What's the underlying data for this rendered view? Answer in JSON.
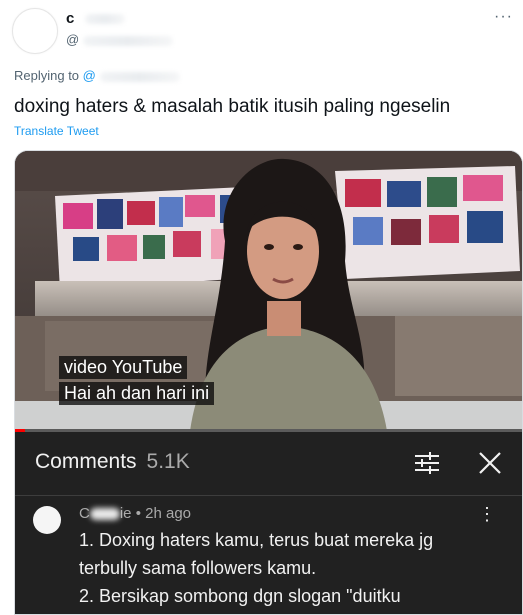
{
  "tweet": {
    "author_name": "c",
    "author_handle": "@",
    "replying_label": "Replying to",
    "replying_mention": "@",
    "text": "doxing haters & masalah batik itusih paling ngeselin",
    "translate_label": "Translate Tweet",
    "more_icon": "more-icon"
  },
  "video": {
    "caption_lines": [
      "video YouTube",
      "Hai ah dan hari ini"
    ],
    "progress": 0.02,
    "progress_color": "#ff0000"
  },
  "comments": {
    "title": "Comments",
    "count": "5.1K",
    "sort_icon": "sort-icon",
    "close_icon": "close-icon",
    "item": {
      "author": "ie",
      "author_prefix": "C",
      "time": "• 2h ago",
      "lines": [
        "1. Doxing haters kamu, terus buat mereka jg",
        "terbully sama followers kamu.",
        "2. Bersikap sombong dgn slogan \"duitku"
      ]
    }
  },
  "colors": {
    "link": "#1d9bf0",
    "panel_bg": "#212121"
  }
}
